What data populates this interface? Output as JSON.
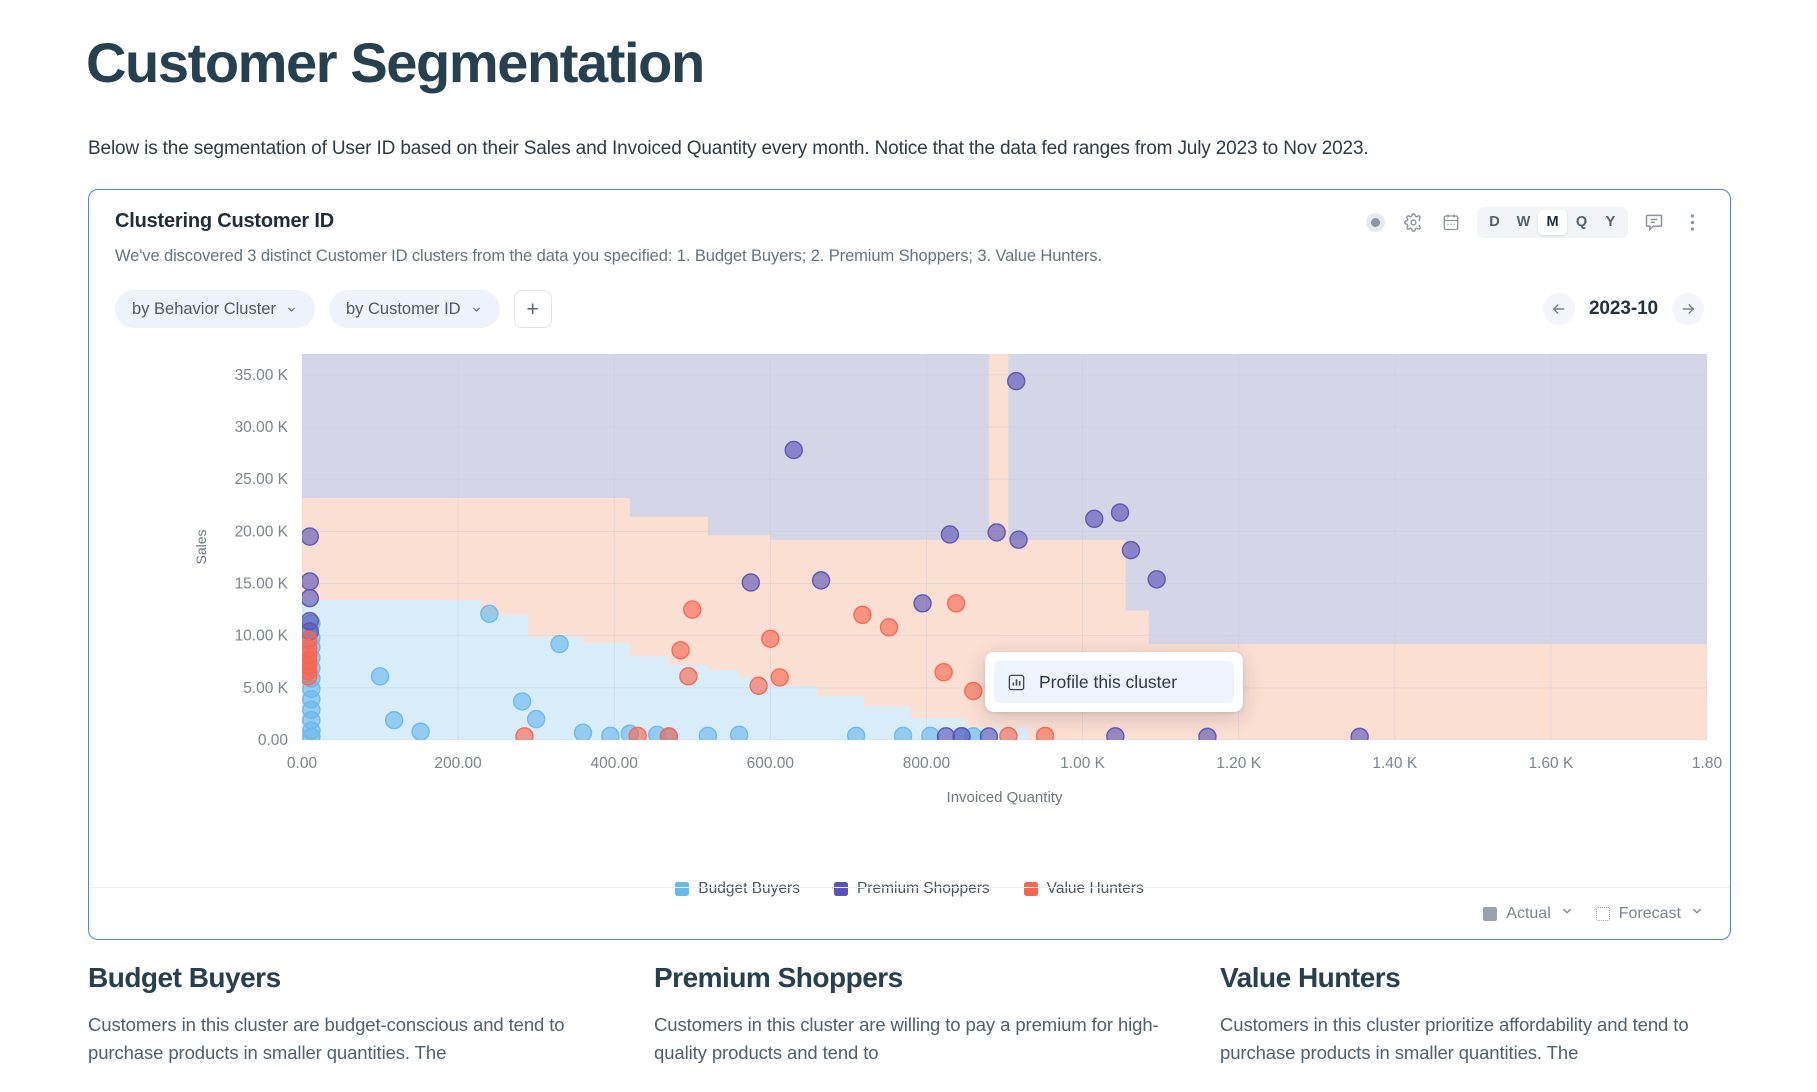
{
  "page": {
    "title": "Customer Segmentation",
    "subtitle": "Below is the segmentation of User ID based on their Sales and Invoiced Quantity every month. Notice that the data fed ranges from July 2023 to Nov 2023."
  },
  "card": {
    "title": "Clustering Customer ID",
    "description": "We've discovered 3 distinct Customer ID clusters from the data you specified: 1. Budget Buyers; 2. Premium Shoppers; 3. Value Hunters.",
    "tools": {
      "status_icon": "record-dot-icon",
      "settings_icon": "gear-icon",
      "calendar_icon": "calendar-icon",
      "comment_icon": "comment-icon",
      "more_icon": "kebab-menu-icon",
      "granularity": [
        "D",
        "W",
        "M",
        "Q",
        "Y"
      ],
      "granularity_selected": "M"
    },
    "chips": [
      {
        "label": "by Behavior Cluster",
        "icon": "chevron-down-icon"
      },
      {
        "label": "by Customer ID",
        "icon": "chevron-down-icon"
      }
    ],
    "add_chip_label": "+",
    "date_nav": {
      "prev_icon": "arrow-left-icon",
      "value": "2023-10",
      "next_icon": "arrow-right-icon"
    },
    "context_menu": {
      "icon": "bar-chart-icon",
      "label": "Profile this cluster"
    },
    "footer": [
      {
        "label": "Actual",
        "swatch": "solid",
        "icon": "chevron-down-icon"
      },
      {
        "label": "Forecast",
        "swatch": "dotted",
        "icon": "chevron-down-icon"
      }
    ]
  },
  "chart_data": {
    "type": "scatter",
    "title": "Clustering Customer ID",
    "xlabel": "Invoiced Quantity",
    "ylabel": "Sales",
    "xlim": [
      0,
      1800
    ],
    "ylim": [
      0,
      37000
    ],
    "grid": true,
    "legend_position": "bottom",
    "xticks": [
      "0.00",
      "200.00",
      "400.00",
      "600.00",
      "800.00",
      "1.00 K",
      "1.20 K",
      "1.40 K",
      "1.60 K",
      "1.80"
    ],
    "xtick_values": [
      0,
      200,
      400,
      600,
      800,
      1000,
      1200,
      1400,
      1600,
      1800
    ],
    "yticks": [
      "0.00",
      "5.00 K",
      "10.00 K",
      "15.00 K",
      "20.00 K",
      "25.00 K",
      "30.00 K",
      "35.00 K"
    ],
    "ytick_values": [
      0,
      5000,
      10000,
      15000,
      20000,
      25000,
      30000,
      35000
    ],
    "colors": {
      "budget_buyers": "#69b8ec",
      "premium_shoppers": "#5b52b8",
      "value_hunters": "#f9664f",
      "region_budget_buyers": "#d9ecfa",
      "region_premium_shoppers": "#d5d5e8",
      "region_value_hunters": "#fbdfd3"
    },
    "series": [
      {
        "name": "Budget Buyers",
        "color": "#69b8ec",
        "points": [
          [
            12,
            11200
          ],
          [
            12,
            9800
          ],
          [
            12,
            8900
          ],
          [
            12,
            7900
          ],
          [
            12,
            6900
          ],
          [
            12,
            5900
          ],
          [
            12,
            4900
          ],
          [
            12,
            3900
          ],
          [
            12,
            2900
          ],
          [
            12,
            1900
          ],
          [
            12,
            900
          ],
          [
            12,
            300
          ],
          [
            100,
            6100
          ],
          [
            118,
            1900
          ],
          [
            152,
            800
          ],
          [
            240,
            12100
          ],
          [
            282,
            3700
          ],
          [
            300,
            2000
          ],
          [
            330,
            9200
          ],
          [
            360,
            700
          ],
          [
            395,
            400
          ],
          [
            420,
            600
          ],
          [
            455,
            500
          ],
          [
            470,
            300
          ],
          [
            520,
            400
          ],
          [
            560,
            500
          ],
          [
            710,
            400
          ],
          [
            770,
            400
          ],
          [
            805,
            400
          ],
          [
            845,
            350
          ],
          [
            860,
            350
          ]
        ]
      },
      {
        "name": "Premium Shoppers",
        "color": "#5b52b8",
        "points": [
          [
            10,
            19500
          ],
          [
            10,
            15200
          ],
          [
            10,
            13600
          ],
          [
            10,
            11400
          ],
          [
            10,
            10400
          ],
          [
            575,
            15100
          ],
          [
            630,
            27800
          ],
          [
            665,
            15300
          ],
          [
            795,
            13100
          ],
          [
            830,
            19700
          ],
          [
            890,
            19900
          ],
          [
            915,
            34400
          ],
          [
            918,
            19200
          ],
          [
            1015,
            21200
          ],
          [
            1048,
            21800
          ],
          [
            1062,
            18200
          ],
          [
            1095,
            15400
          ],
          [
            1042,
            350
          ],
          [
            1160,
            300
          ],
          [
            1355,
            300
          ],
          [
            825,
            350
          ],
          [
            845,
            360
          ],
          [
            880,
            340
          ]
        ]
      },
      {
        "name": "Value Hunters",
        "color": "#f9664f",
        "points": [
          [
            8,
            9600
          ],
          [
            8,
            8800
          ],
          [
            8,
            8200
          ],
          [
            8,
            7600
          ],
          [
            8,
            7100
          ],
          [
            8,
            6600
          ],
          [
            8,
            6100
          ],
          [
            285,
            350
          ],
          [
            430,
            400
          ],
          [
            470,
            350
          ],
          [
            500,
            12500
          ],
          [
            485,
            8600
          ],
          [
            495,
            6100
          ],
          [
            585,
            5200
          ],
          [
            600,
            9700
          ],
          [
            612,
            6000
          ],
          [
            718,
            12000
          ],
          [
            752,
            10800
          ],
          [
            822,
            6500
          ],
          [
            838,
            13100
          ],
          [
            860,
            4700
          ],
          [
            905,
            380
          ],
          [
            952,
            390
          ]
        ]
      }
    ]
  },
  "clusters": [
    {
      "title": "Budget Buyers",
      "body": "Customers in this cluster are budget-conscious and tend to purchase products in smaller quantities. The"
    },
    {
      "title": "Premium Shoppers",
      "body": "Customers in this cluster are willing to pay a premium for high-quality products and tend to"
    },
    {
      "title": "Value Hunters",
      "body": "Customers in this cluster prioritize affordability and tend to purchase products in smaller quantities. The"
    }
  ]
}
